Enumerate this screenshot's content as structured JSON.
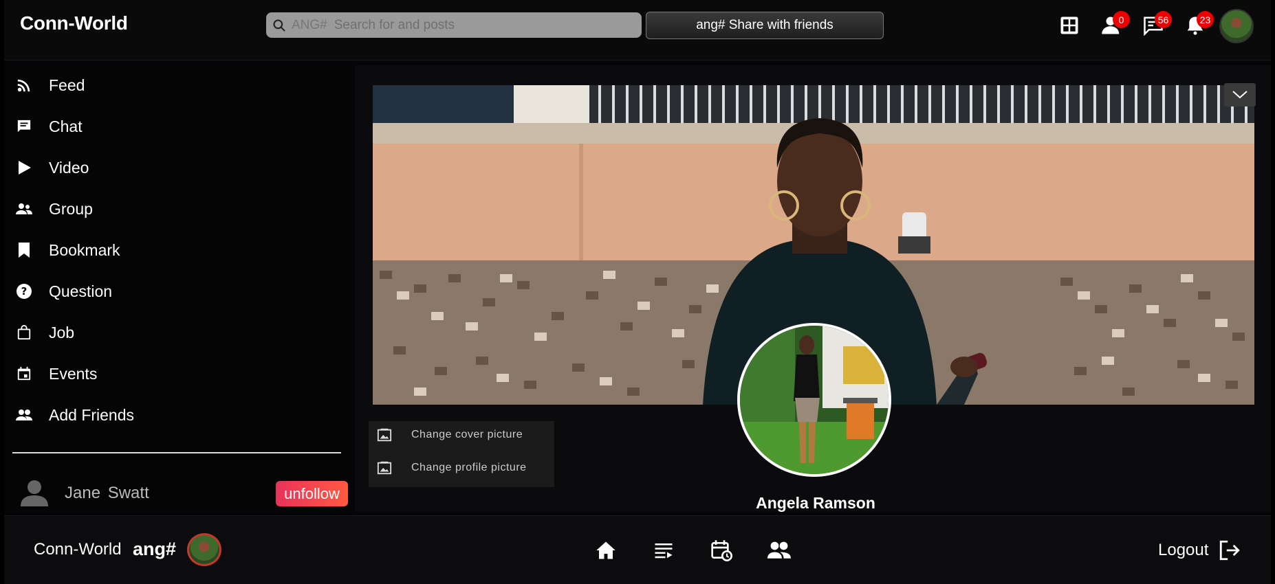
{
  "app": {
    "brand": "Conn-World"
  },
  "header": {
    "search": {
      "tag": "ANG#",
      "placeholder": "Search for and posts"
    },
    "share_label": "ang# Share with friends",
    "icons": [
      {
        "name": "apps-grid-icon"
      },
      {
        "name": "friend-requests-icon",
        "badge": "0"
      },
      {
        "name": "messages-icon",
        "badge": "56"
      },
      {
        "name": "notifications-icon",
        "badge": "23"
      }
    ]
  },
  "sidebar": {
    "items": [
      {
        "label": "Feed",
        "icon": "rss-feed-icon"
      },
      {
        "label": "Chat",
        "icon": "chat-icon"
      },
      {
        "label": "Video",
        "icon": "play-icon"
      },
      {
        "label": "Group",
        "icon": "group-icon"
      },
      {
        "label": "Bookmark",
        "icon": "bookmark-icon"
      },
      {
        "label": "Question",
        "icon": "question-icon"
      },
      {
        "label": "Job",
        "icon": "bag-icon"
      },
      {
        "label": "Events",
        "icon": "calendar-icon"
      },
      {
        "label": "Add Friends",
        "icon": "people-icon"
      }
    ],
    "friend": {
      "name": "Jane Swatt",
      "action": "unfollow"
    }
  },
  "profile": {
    "name": "Angela Ramson",
    "menu": [
      {
        "label": "Change cover picture",
        "icon": "image-icon"
      },
      {
        "label": "Change profile picture",
        "icon": "image-icon"
      }
    ]
  },
  "footer": {
    "brand": "Conn-World",
    "tag": "ang#",
    "nav_icons": [
      "home-icon",
      "feed-list-icon",
      "event-history-icon",
      "friends-icon"
    ],
    "logout_label": "Logout"
  }
}
